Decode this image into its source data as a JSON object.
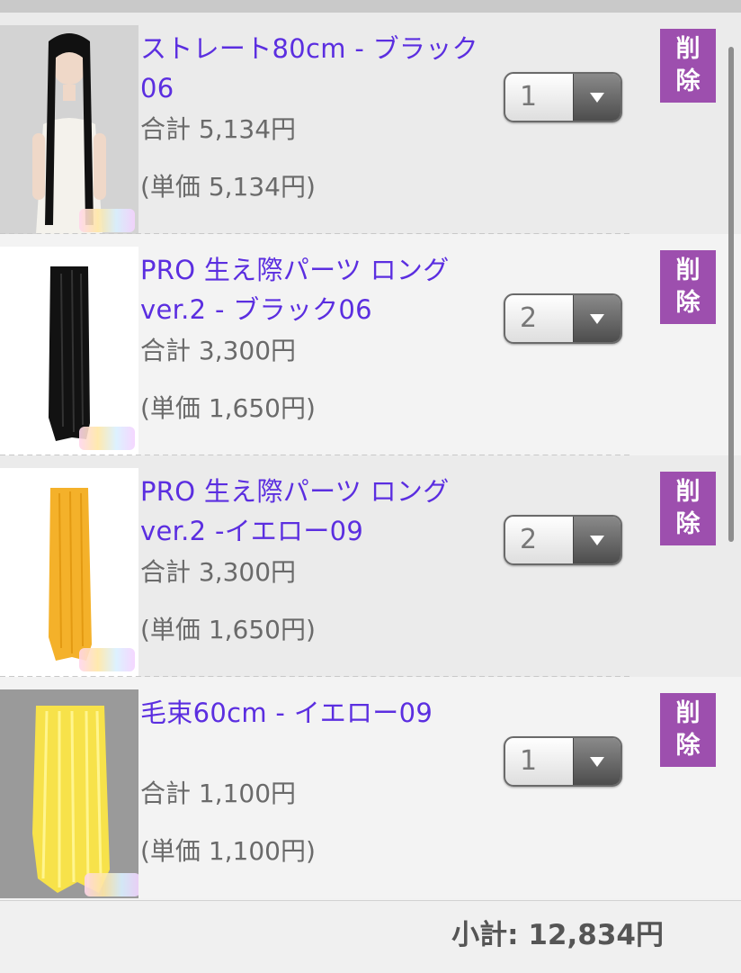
{
  "cart": {
    "items": [
      {
        "name": "ストレート80cm - ブラック06",
        "total": "合計 5,134円",
        "unit": "(単価 5,134円)",
        "qty": "1",
        "delete_label": "削除"
      },
      {
        "name": "PRO 生え際パーツ ロング ver.2 - ブラック06",
        "total": "合計 3,300円",
        "unit": "(単価 1,650円)",
        "qty": "2",
        "delete_label": "削除"
      },
      {
        "name": "PRO 生え際パーツ ロング ver.2 -イエロー09",
        "total": "合計 3,300円",
        "unit": "(単価 1,650円)",
        "qty": "2",
        "delete_label": "削除"
      },
      {
        "name": "毛束60cm - イエロー09",
        "total": "合計 1,100円",
        "unit": "(単価 1,100円)",
        "qty": "1",
        "delete_label": "削除"
      }
    ],
    "subtotal": "小計: 12,834円"
  },
  "colors": {
    "link": "#5b2ee0",
    "delete_button": "#9d4fae",
    "text_gray": "#6a6a6a"
  },
  "icons": [
    "dropdown-arrow-icon"
  ]
}
